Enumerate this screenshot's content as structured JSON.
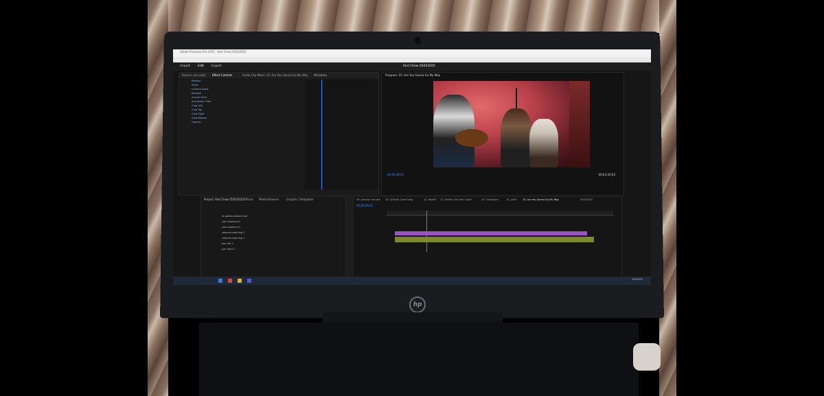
{
  "titlebar": {
    "app_title": "Adobe Premiere Pro 2025 - Red Chew 05052025"
  },
  "workspace": {
    "items": [
      "Import",
      "Edit",
      "Export"
    ],
    "sequence_title": "Red Chew 05052025"
  },
  "effect_controls": {
    "tabs": [
      "Source: (no clips)",
      "Effect Controls",
      "Audio Clip Mixer: 15. Are You Gonna Go My Way",
      "Metadata"
    ],
    "rows": [
      "Position",
      "Scale",
      "Uniform Scale",
      "Rotation",
      "Anchor Point",
      "Anti-flicker Filter",
      "Crop Left",
      "Crop Top",
      "Crop Right",
      "Crop Bottom",
      "Opacity"
    ]
  },
  "program": {
    "title": "Program: 15. Are You Gonna Go My Way",
    "timecode_left": "00;00;49;01",
    "timecode_right": "00;03;35;03"
  },
  "project": {
    "tabs": [
      "Project: Red Chew 05052025",
      "Effects",
      "Media Browser",
      "Graphics Templates"
    ],
    "items": [
      "to-gallow-teaser.mod",
      "cam-zooming 2",
      "cam-zooming 3",
      "zoomed-zooming 2",
      "zoomed-zooming 3",
      "pan left 1",
      "pan right 1"
    ]
  },
  "timeline": {
    "tabs": [
      "09. Another Sunday",
      "10. Schindlr Love Song",
      "12. Woo87",
      "13. Smells Like Teen Spirit",
      "14. Crosstown",
      "15. Alive",
      "15. Are You Gonna Go My Way",
      "05052025"
    ],
    "timecode": "00;00;49;01"
  },
  "taskbar": {
    "clock": "5/5/2025"
  }
}
